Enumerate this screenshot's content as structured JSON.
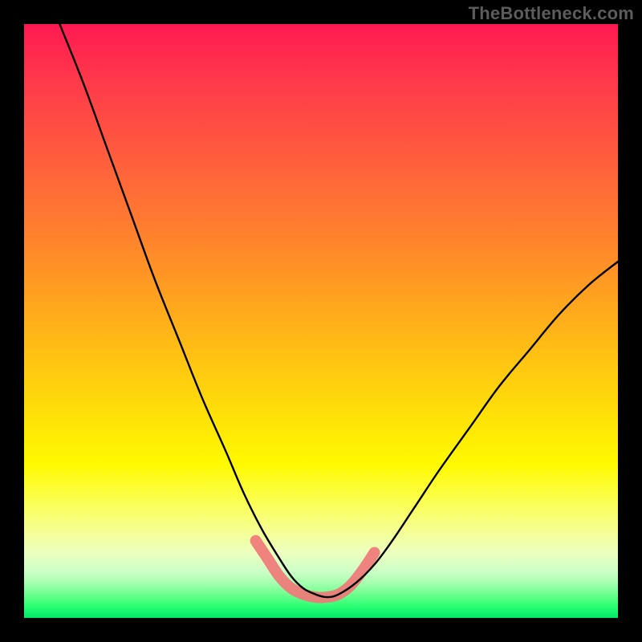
{
  "watermark": "TheBottleneck.com",
  "colors": {
    "marker": "#f07878",
    "curve": "#000000",
    "gradient_top": "#ff1a52",
    "gradient_bottom": "#00e86a"
  },
  "chart_data": {
    "type": "line",
    "title": "",
    "xlabel": "",
    "ylabel": "",
    "xlim": [
      0,
      100
    ],
    "ylim": [
      0,
      100
    ],
    "grid": false,
    "legend": false,
    "series": [
      {
        "name": "bottleneck-curve",
        "x": [
          6,
          10,
          14,
          18,
          22,
          26,
          30,
          34,
          37,
          40,
          43,
          45,
          47,
          49,
          51,
          53,
          56,
          59,
          62,
          66,
          70,
          75,
          80,
          85,
          90,
          95,
          100
        ],
        "y": [
          100,
          90,
          79,
          68,
          57,
          47,
          37,
          28,
          21,
          15,
          10,
          7,
          5,
          4,
          3.5,
          4,
          6,
          9,
          13,
          19,
          25,
          32,
          39,
          45,
          51,
          56,
          60
        ]
      }
    ],
    "markers": {
      "name": "highlight-band",
      "color": "#f07878",
      "x": [
        39,
        41,
        43,
        45,
        47,
        49,
        51,
        53,
        55,
        57,
        59
      ],
      "y": [
        13,
        10,
        7,
        5,
        4,
        3.5,
        3.5,
        4,
        5.5,
        8,
        11
      ]
    }
  }
}
